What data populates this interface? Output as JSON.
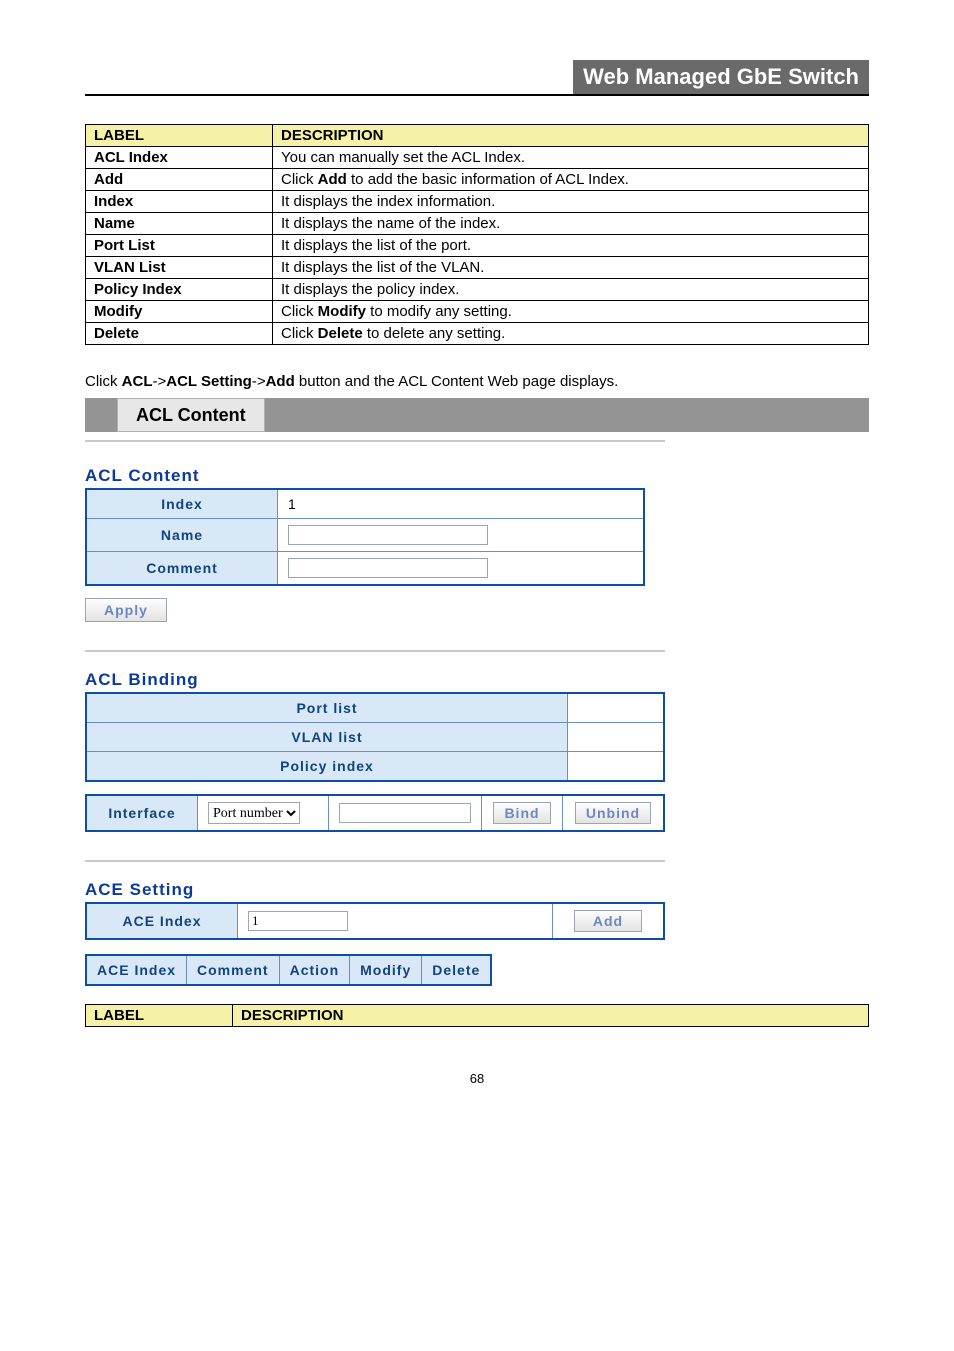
{
  "header": {
    "title": "Web Managed GbE Switch"
  },
  "desc_table": {
    "headers": [
      "LABEL",
      "DESCRIPTION"
    ],
    "rows": [
      {
        "label": "ACL Index",
        "desc_pre": "You can manually set the ACL Index.",
        "bold": "",
        "desc_post": ""
      },
      {
        "label": "Add",
        "desc_pre": "Click ",
        "bold": "Add",
        "desc_post": " to add the basic information of ACL Index."
      },
      {
        "label": "Index",
        "desc_pre": "It displays the index information.",
        "bold": "",
        "desc_post": ""
      },
      {
        "label": "Name",
        "desc_pre": "It displays the name of the index.",
        "bold": "",
        "desc_post": ""
      },
      {
        "label": "Port List",
        "desc_pre": "It displays the list of the port.",
        "bold": "",
        "desc_post": ""
      },
      {
        "label": "VLAN List",
        "desc_pre": "It displays the list of the VLAN.",
        "bold": "",
        "desc_post": ""
      },
      {
        "label": "Policy Index",
        "desc_pre": "It displays the policy index.",
        "bold": "",
        "desc_post": ""
      },
      {
        "label": "Modify",
        "desc_pre": "Click ",
        "bold": "Modify",
        "desc_post": " to modify any setting."
      },
      {
        "label": "Delete",
        "desc_pre": "Click ",
        "bold": "Delete",
        "desc_post": " to delete any setting."
      }
    ]
  },
  "instr": {
    "p1a": "Click ",
    "p1b": "ACL",
    "p1c": "->",
    "p1d": "ACL Setting",
    "p1e": "->",
    "p1f": "Add",
    "p1g": " button and the ACL Content Web page displays."
  },
  "tab": {
    "label": "ACL Content"
  },
  "acl_content": {
    "title": "ACL Content",
    "rows": {
      "index_label": "Index",
      "index_value": "1",
      "name_label": "Name",
      "name_value": "",
      "comment_label": "Comment",
      "comment_value": ""
    },
    "apply": "Apply"
  },
  "acl_binding": {
    "title": "ACL Binding",
    "rows": {
      "port_list": "Port list",
      "vlan_list": "VLAN list",
      "policy_index": "Policy index"
    },
    "interface_label": "Interface",
    "interface_select": "Port number",
    "bind": "Bind",
    "unbind": "Unbind"
  },
  "ace_setting": {
    "title": "ACE Setting",
    "ace_index_label": "ACE Index",
    "ace_index_value": "1",
    "add": "Add",
    "cols": {
      "c1": "ACE Index",
      "c2": "Comment",
      "c3": "Action",
      "c4": "Modify",
      "c5": "Delete"
    }
  },
  "desc_table2": {
    "headers": [
      "LABEL",
      "DESCRIPTION"
    ]
  },
  "page_number": "68"
}
